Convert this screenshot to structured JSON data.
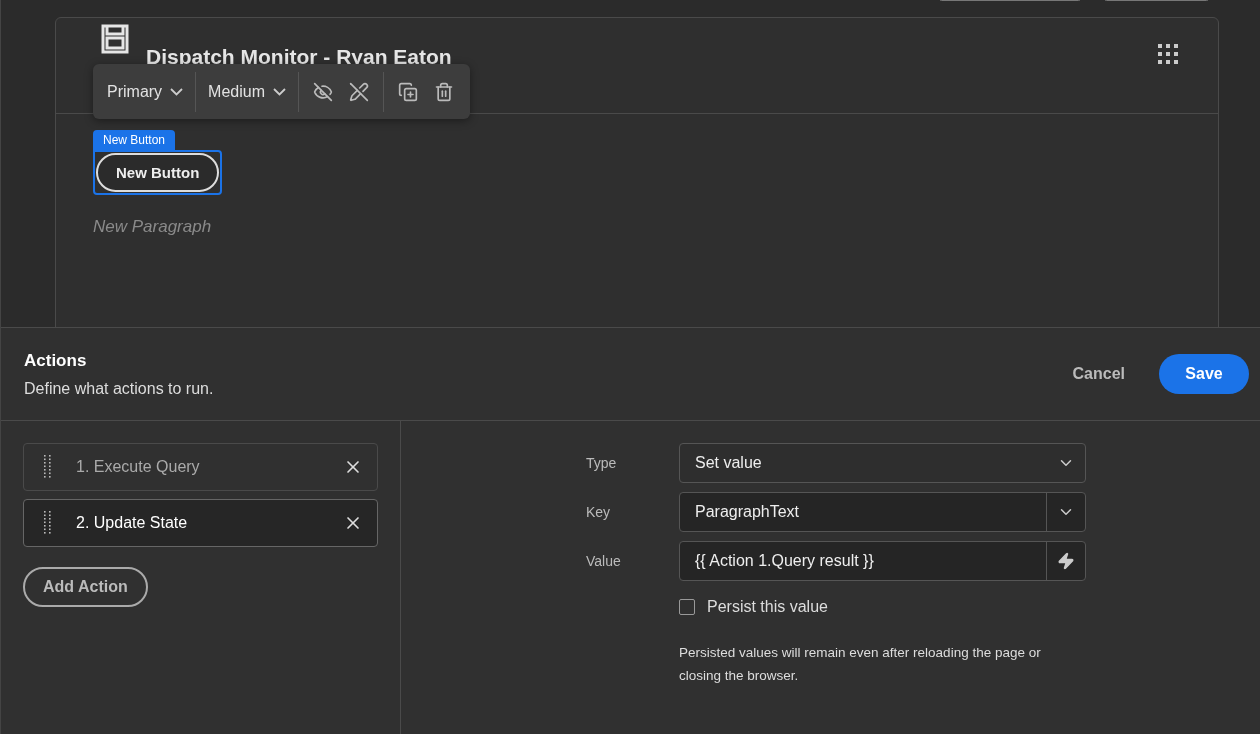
{
  "canvas": {
    "app_title": "Dispatch Monitor - Ryan Eaton",
    "toolbar": {
      "variant": "Primary",
      "size": "Medium"
    },
    "selected_label": "New Button",
    "button": "New Button",
    "paragraph": "New Paragraph"
  },
  "actions_panel": {
    "title": "Actions",
    "subtitle": "Define what actions to run.",
    "cancel": "Cancel",
    "save": "Save",
    "actions": [
      {
        "label": "1. Execute Query",
        "selected": false
      },
      {
        "label": "2. Update State",
        "selected": true
      }
    ],
    "add_action": "Add Action",
    "form": {
      "type_label": "Type",
      "type_value": "Set value",
      "key_label": "Key",
      "key_value": "ParagraphText",
      "value_label": "Value",
      "value_value": "{{ Action 1.Query result }}",
      "persist": {
        "label": "Persist this value",
        "checked": false
      },
      "note": "Persisted values will remain even after reloading the page or closing the browser."
    }
  }
}
